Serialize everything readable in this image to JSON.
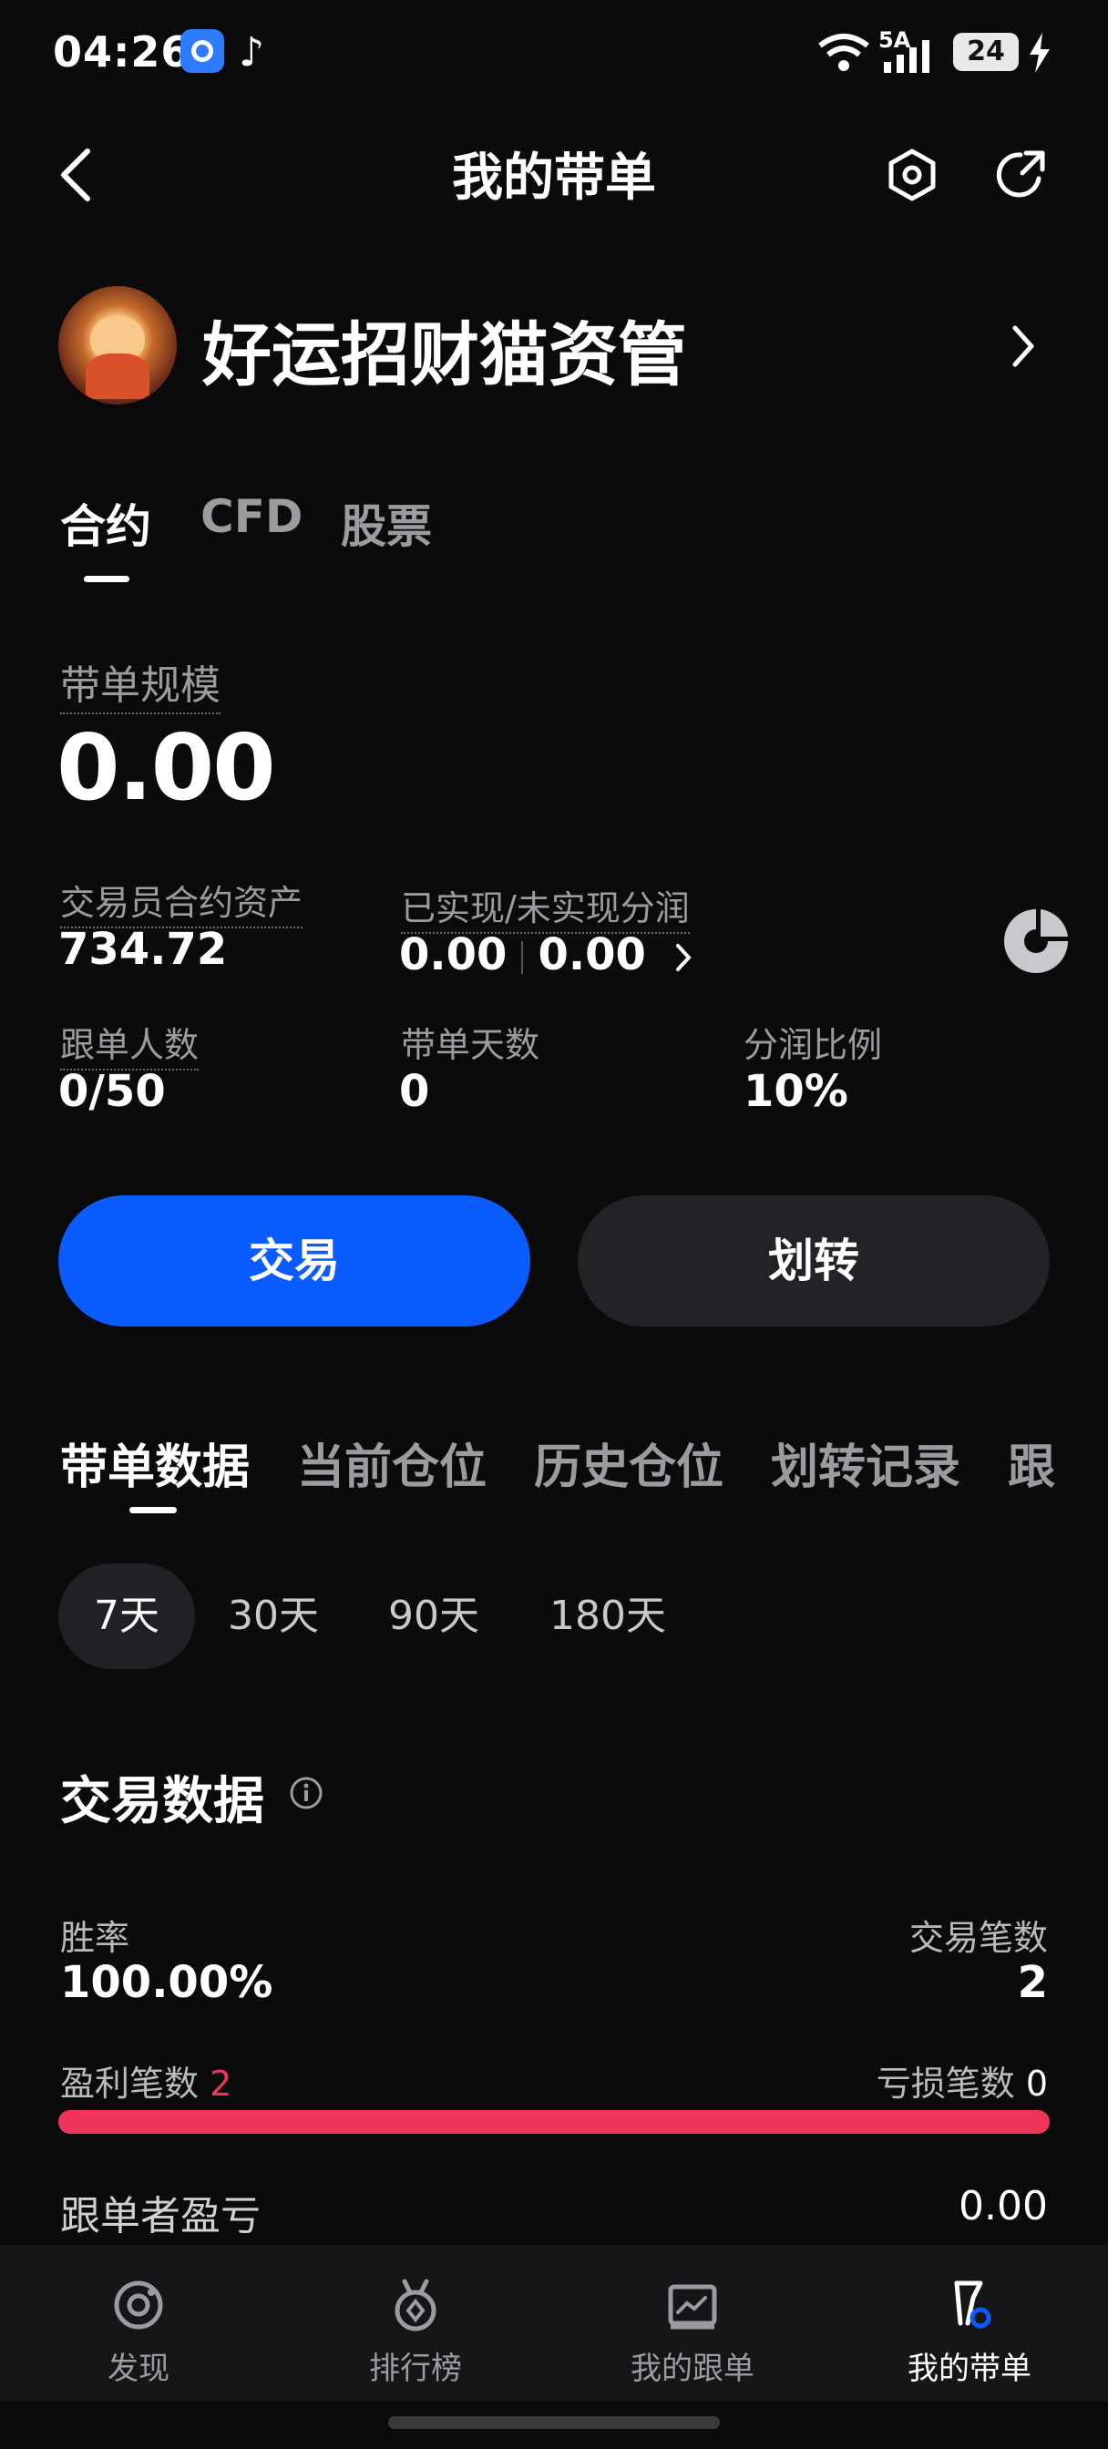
{
  "status_bar": {
    "time": "04:26",
    "network": "5A",
    "battery": "24"
  },
  "header": {
    "title": "我的带单",
    "icons": [
      "back-icon",
      "hexagon-settings-icon",
      "share-icon"
    ]
  },
  "profile": {
    "name": "好运招财猫资管"
  },
  "asset_tabs": [
    {
      "label": "合约",
      "active": true
    },
    {
      "label": "CFD",
      "active": false
    },
    {
      "label": "股票",
      "active": false
    }
  ],
  "summary": {
    "scale_label": "带单规模",
    "scale_value": "0.00",
    "contract_assets_label": "交易员合约资产",
    "contract_assets_value": "734.72",
    "profit_share_label": "已实现/未实现分润",
    "realized_value": "0.00",
    "unrealized_value": "0.00",
    "followers_label": "跟单人数",
    "followers_value": "0/50",
    "days_label": "带单天数",
    "days_value": "0",
    "ratio_label": "分润比例",
    "ratio_value": "10%"
  },
  "actions": {
    "trade_label": "交易",
    "transfer_label": "划转"
  },
  "data_tabs": [
    {
      "label": "带单数据",
      "active": true
    },
    {
      "label": "当前仓位",
      "active": false
    },
    {
      "label": "历史仓位",
      "active": false
    },
    {
      "label": "划转记录",
      "active": false
    },
    {
      "label": "跟",
      "active": false
    }
  ],
  "periods": [
    {
      "label": "7天",
      "active": true
    },
    {
      "label": "30天",
      "active": false
    },
    {
      "label": "90天",
      "active": false
    },
    {
      "label": "180天",
      "active": false
    }
  ],
  "trading_data": {
    "title": "交易数据",
    "win_rate_label": "胜率",
    "win_rate_value": "100.00%",
    "trade_count_label": "交易笔数",
    "trade_count_value": "2",
    "profit_count_label": "盈利笔数",
    "profit_count_value": "2",
    "loss_count_label": "亏损笔数",
    "loss_count_value": "0",
    "profit_ratio": 1.0,
    "follower_pnl_label": "跟单者盈亏",
    "follower_pnl_value": "0.00"
  },
  "colors": {
    "accent_blue": "#0a5cff",
    "profit_red": "#f0345a",
    "background": "#0b0b0c"
  },
  "bottom_nav": [
    {
      "label": "发现",
      "icon": "discover-icon",
      "active": false
    },
    {
      "label": "排行榜",
      "icon": "medal-icon",
      "active": false
    },
    {
      "label": "我的跟单",
      "icon": "chart-icon",
      "active": false
    },
    {
      "label": "我的带单",
      "icon": "flag-icon",
      "active": true
    }
  ]
}
